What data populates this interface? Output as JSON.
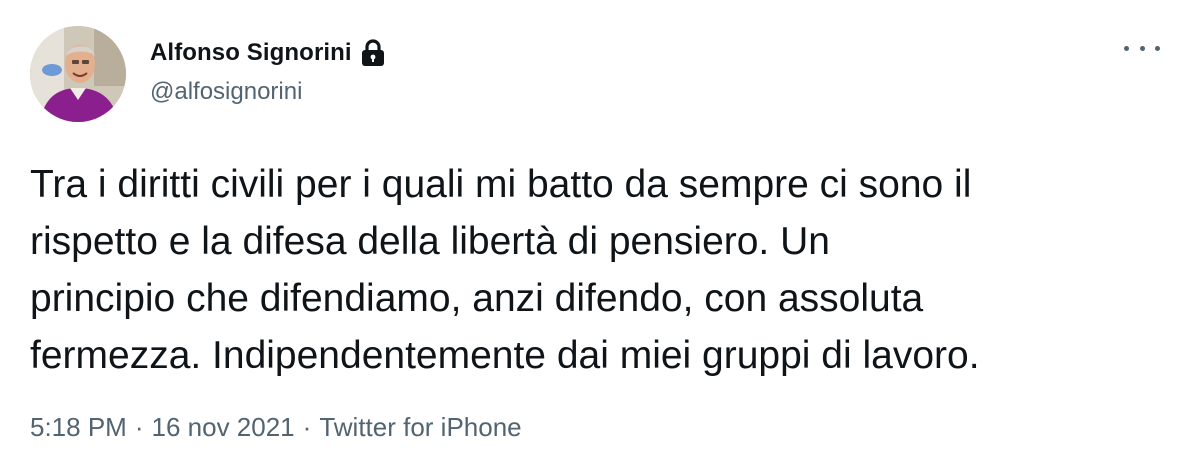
{
  "author": {
    "display_name": "Alfonso Signorini",
    "handle": "@alfosignorini",
    "protected": true,
    "lock_icon": "lock-icon"
  },
  "tweet": {
    "text_lines": [
      "Tra i diritti civili per i quali mi batto da sempre ci sono il",
      "rispetto e la difesa della libertà di pensiero. Un",
      "principio che difendiamo, anzi difendo, con assoluta",
      "fermezza. Indipendentemente dai miei gruppi di lavoro."
    ]
  },
  "meta": {
    "time": "5:18 PM",
    "separator": "·",
    "date": "16 nov 2021",
    "source": "Twitter for iPhone"
  },
  "actions": {
    "more_icon": "more-options-icon"
  },
  "colors": {
    "text_primary": "#0f1419",
    "text_secondary": "#536471",
    "background": "#ffffff",
    "avatar_sweater": "#8b1f8e"
  }
}
